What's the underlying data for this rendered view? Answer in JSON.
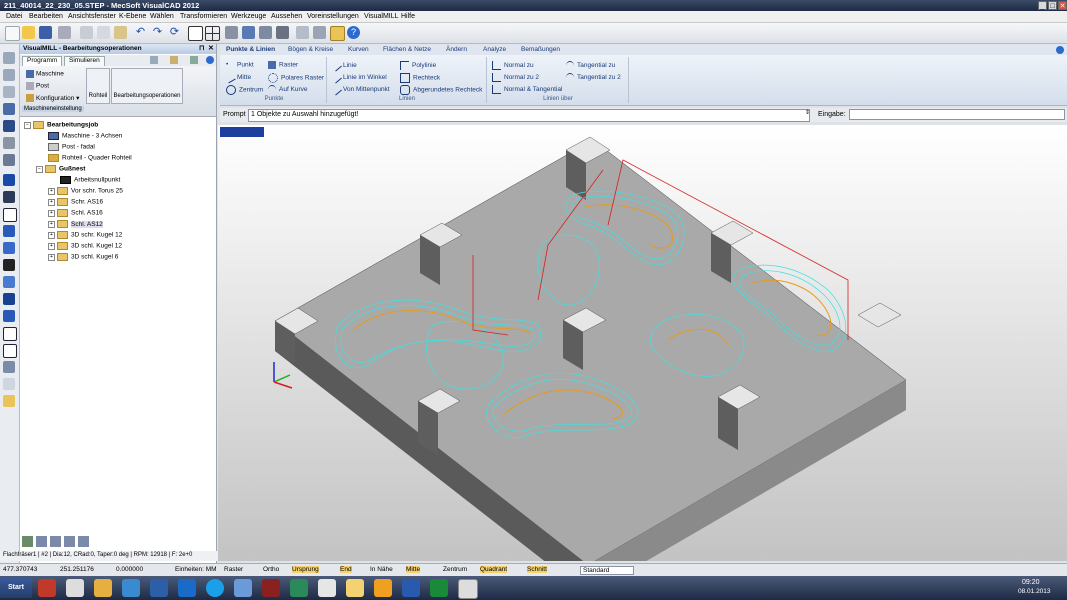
{
  "window": {
    "title": "211_40014_22_230_05.STEP - MecSoft VisualCAD 2012",
    "min": "_",
    "max": "□",
    "close": "✕"
  },
  "menu": [
    "Datei",
    "Bearbeiten",
    "Ansichtsfenster",
    "K-Ebene",
    "Wählen",
    "Transformieren",
    "Werkzeuge",
    "Aussehen",
    "Voreinstellungen",
    "VisualMILL",
    "Hilfe"
  ],
  "panel": {
    "title": "VisualMILL - Bearbeitungsoperationen",
    "tabs": [
      "Programm",
      "Simulieren"
    ],
    "buttons": {
      "machine": "Maschine",
      "post": "Post",
      "config": "Konfiguration",
      "rohteil": "Rohteil",
      "ops": "Bearbeitungsoperationen",
      "section": "Maschineneinstellung"
    },
    "tree": [
      {
        "label": "Bearbeitungsjob",
        "bold": true
      },
      {
        "label": "Maschine - 3 Achsen"
      },
      {
        "label": "Post - fadal"
      },
      {
        "label": "Rohteil - Quader Rohteil"
      },
      {
        "label": "Gußnest",
        "bold": true
      },
      {
        "label": "Arbeitsnullpunkt"
      },
      {
        "label": "Vor schr. Torus 25"
      },
      {
        "label": "Schr. AS16"
      },
      {
        "label": "Schl. AS16"
      },
      {
        "label": "Schl. AS12"
      },
      {
        "label": "3D schr. Kugel 12"
      },
      {
        "label": "3D schl. Kugel 12"
      },
      {
        "label": "3D schl. Kugel 6"
      }
    ],
    "statusline": "Flachfräser1 | #2 | Dia:12, CRad:0, Taper:0 deg | RPM: 12918 | F: 2e+0"
  },
  "ribbon": {
    "tabs": [
      "Punkte & Linien",
      "Bögen & Kreise",
      "Kurven",
      "Flächen & Netze",
      "Ändern",
      "Analyze",
      "Bemaßungen"
    ],
    "groups": [
      {
        "label": "Punkte",
        "items": [
          "Punkt",
          "Mitte",
          "Zentrum",
          "Raster",
          "Polares Raster",
          "Auf Kurve"
        ]
      },
      {
        "label": "Linien",
        "items": [
          "Linie",
          "Linie im Winkel",
          "Von Mittenpunkt",
          "Polylinie",
          "Rechteck",
          "Abgerundetes Rechteck"
        ]
      },
      {
        "label": "Linien über",
        "items": [
          "Normal zu",
          "Normal zu 2",
          "Normal & Tangential",
          "Tangential zu",
          "Tangential zu 2"
        ]
      }
    ]
  },
  "prompt": {
    "label": "Prompt",
    "text": "1 Objekte zu Auswahl hinzugefügt!",
    "input_label": "Eingabe:"
  },
  "status": {
    "x": "477.370743",
    "y": "251.251176",
    "z": "0.000000",
    "units": "Einheiten: MM",
    "snaps": [
      "Raster",
      "Ortho",
      "Ursprung",
      "End",
      "In Nähe",
      "Mitte",
      "Zentrum",
      "Quadrant",
      "Schnitt"
    ],
    "layer": "Standard"
  },
  "taskbar": {
    "start": "Start",
    "time": "09:20",
    "date": "08.01.2013"
  },
  "colors": {
    "toolpath_cyan": "#3fe0e0",
    "toolpath_orange": "#e89a1a",
    "link_red": "#d42020",
    "part_top": "#a8a8a8",
    "part_wall": "#5f5f5f"
  }
}
